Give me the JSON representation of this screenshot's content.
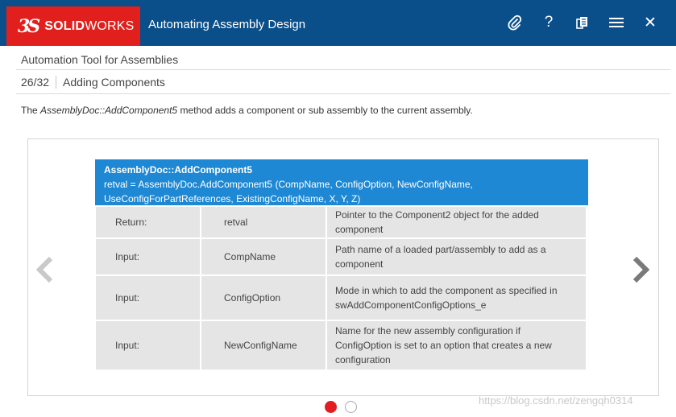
{
  "header": {
    "logo_ds": "3S",
    "logo_solid": "SOLID",
    "logo_works": "WORKS",
    "app_title": "Automating Assembly Design",
    "icons": [
      "paperclip-icon",
      "help-icon",
      "document-icon",
      "menu-icon",
      "close-icon"
    ],
    "help_glyph": "?",
    "close_glyph": "✕"
  },
  "subtitle": "Automation Tool for Assemblies",
  "breadcrumb": {
    "count": "26/32",
    "label": "Adding Components"
  },
  "intro": {
    "before": "The ",
    "method": "AssemblyDoc::AddComponent5",
    "after": " method adds a component or sub assembly to the current assembly."
  },
  "card": {
    "title": "AssemblyDoc::AddComponent5",
    "signature_line1": "retval = AssemblyDoc.AddComponent5 (CompName, ConfigOption, NewConfigName,",
    "signature_line2": "UseConfigForPartReferences, ExistingConfigName, X, Y, Z)",
    "rows": [
      {
        "kind": "Return:",
        "param": "retval",
        "desc": "Pointer to the Component2 object for the added component"
      },
      {
        "kind": "Input:",
        "param": "CompName",
        "desc": "Path name of a loaded part/assembly to add as a component"
      },
      {
        "kind": "Input:",
        "param": "ConfigOption",
        "desc": "Mode in which to add the component as specified in swAddComponentConfigOptions_e"
      },
      {
        "kind": "Input:",
        "param": "NewConfigName",
        "desc": "Name for the new assembly configuration if ConfigOption is set to an option that creates a new configuration"
      }
    ]
  },
  "pagination": {
    "total": 2,
    "active": 0
  },
  "watermark": "https://blog.csdn.net/zengqh0314",
  "colors": {
    "header_bg": "#0b4f8a",
    "logo_bg": "#e1201d",
    "card_header": "#1e88d4",
    "cell_bg": "#e5e5e5",
    "dot_active": "#e11d21"
  }
}
